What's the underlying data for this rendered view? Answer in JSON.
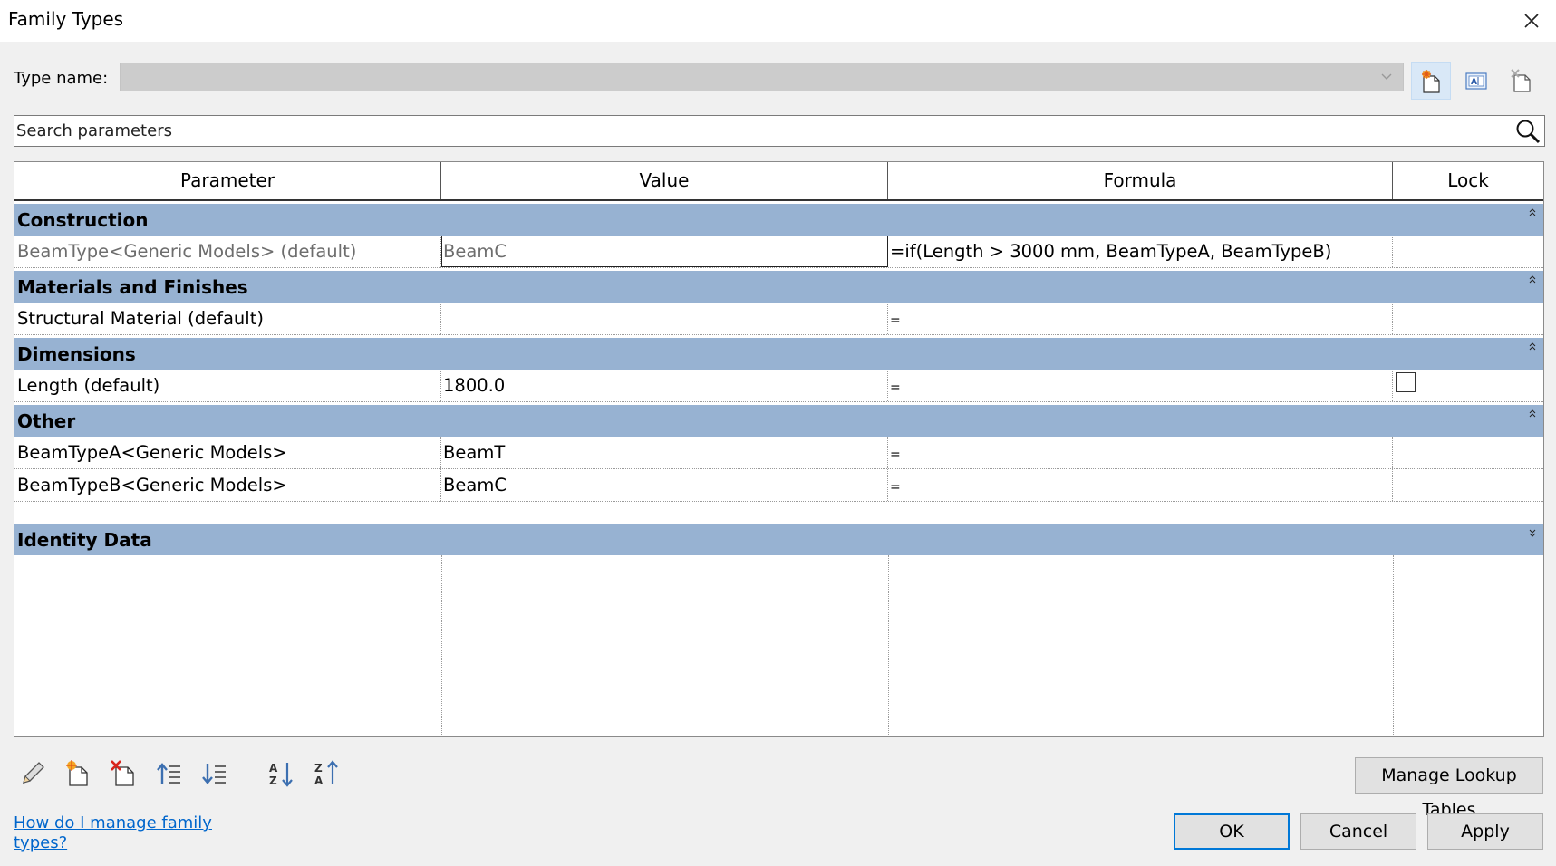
{
  "window": {
    "title": "Family Types"
  },
  "type_name": {
    "label": "Type name:",
    "value": ""
  },
  "search": {
    "placeholder": "Search parameters"
  },
  "columns": {
    "parameter": "Parameter",
    "value": "Value",
    "formula": "Formula",
    "lock": "Lock"
  },
  "groups": {
    "construction": {
      "label": "Construction",
      "rows": [
        {
          "parameter": "BeamType<Generic Models> (default)",
          "value": "BeamC",
          "formula": "=if(Length > 3000 mm, BeamTypeA, BeamTypeB)"
        }
      ]
    },
    "materials": {
      "label": "Materials and Finishes",
      "rows": [
        {
          "parameter": "Structural Material (default)",
          "value": "",
          "formula": "="
        }
      ]
    },
    "dimensions": {
      "label": "Dimensions",
      "rows": [
        {
          "parameter": "Length (default)",
          "value": "1800.0",
          "formula": "=",
          "locked": false
        }
      ]
    },
    "other": {
      "label": "Other",
      "rows": [
        {
          "parameter": "BeamTypeA<Generic Models>",
          "value": "BeamT",
          "formula": "="
        },
        {
          "parameter": "BeamTypeB<Generic Models>",
          "value": "BeamC",
          "formula": "="
        }
      ]
    },
    "identity": {
      "label": "Identity Data",
      "collapsed": true
    }
  },
  "buttons": {
    "manage_lookup": "Manage Lookup Tables",
    "ok": "OK",
    "cancel": "Cancel",
    "apply": "Apply"
  },
  "help_link": "How do I manage family types?",
  "icons": {
    "new_type": "new-type-icon",
    "rename_type": "rename-type-icon",
    "delete_type": "delete-type-icon",
    "edit_parameter": "pencil-icon",
    "new_parameter": "new-parameter-icon",
    "delete_parameter": "delete-parameter-icon",
    "move_up": "move-up-icon",
    "move_down": "move-down-icon",
    "sort_ascending": "sort-ascending-icon",
    "sort_descending": "sort-descending-icon"
  },
  "colors": {
    "group_header": "#97b2d2",
    "dialog_bg": "#f0f0f0",
    "primary_border": "#0078d7",
    "link": "#0066cc"
  }
}
